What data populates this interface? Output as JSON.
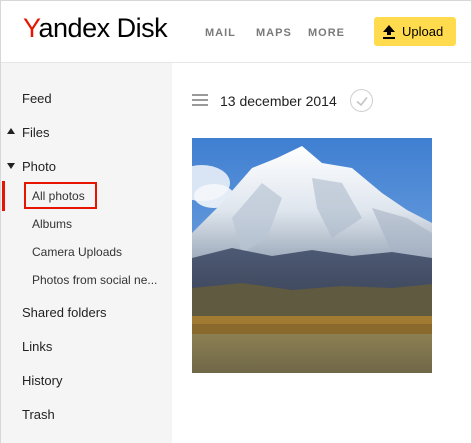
{
  "header": {
    "logo_y": "Y",
    "logo_rest": "andex",
    "logo_disk": "Disk",
    "nav": {
      "mail": "MAIL",
      "maps": "MAPS",
      "more": "MORE"
    },
    "upload_label": "Upload",
    "colors": {
      "brand_red": "#e61400",
      "upload_yellow": "#ffdb4d"
    }
  },
  "sidebar": {
    "feed": "Feed",
    "files": "Files",
    "photo": "Photo",
    "photo_items": {
      "all_photos": "All photos",
      "albums": "Albums",
      "camera_uploads": "Camera Uploads",
      "social": "Photos from social ne..."
    },
    "shared_folders": "Shared folders",
    "links": "Links",
    "history": "History",
    "trash": "Trash",
    "selected": "All photos"
  },
  "main": {
    "date": "13 december 2014",
    "icons": {
      "menu": "hamburger-icon",
      "select": "checkmark-circle-icon"
    }
  }
}
